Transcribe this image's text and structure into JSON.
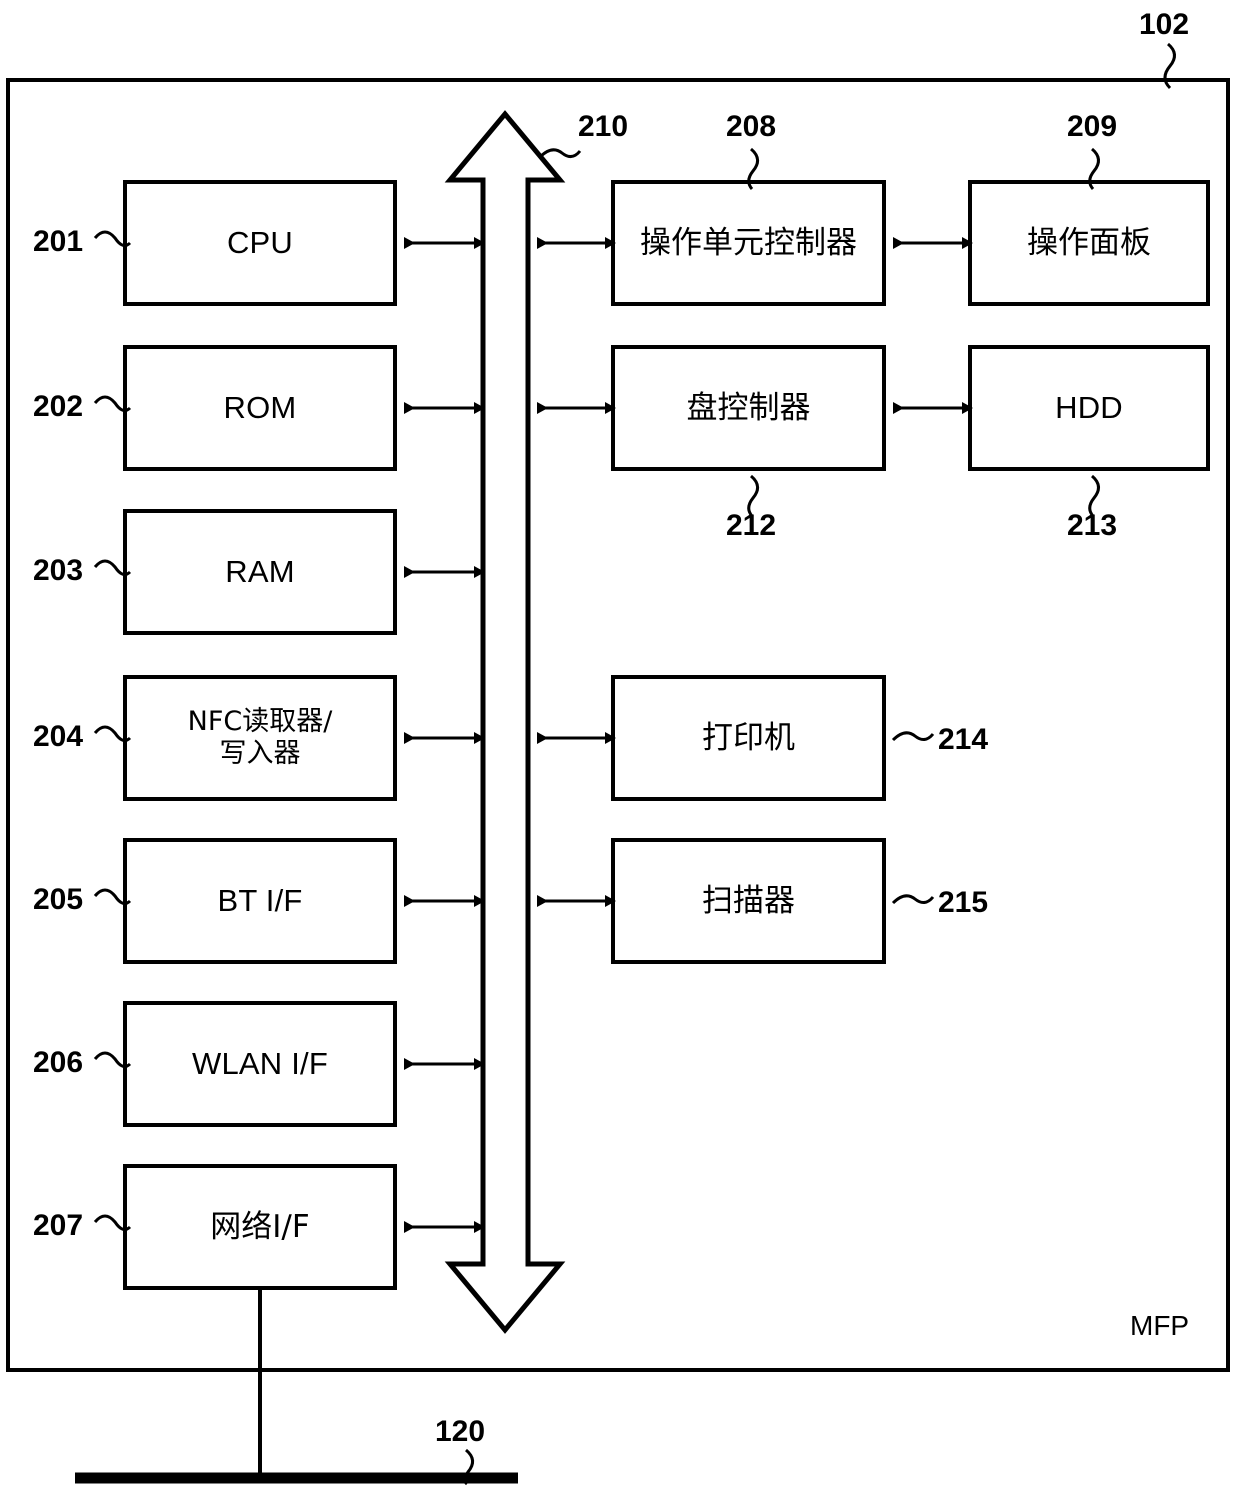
{
  "figure": {
    "outer_label": "102",
    "enclosure_name": "MFP",
    "network_label": "120",
    "bus_label": "210",
    "line_color": "#000000",
    "background_color": "#ffffff"
  },
  "left_column": [
    {
      "ref": "201",
      "label": "CPU",
      "script": "latin"
    },
    {
      "ref": "202",
      "label": "ROM",
      "script": "latin"
    },
    {
      "ref": "203",
      "label": "RAM",
      "script": "latin"
    },
    {
      "ref": "204",
      "label": "NFC读取器/\n写入器",
      "script": "cjk"
    },
    {
      "ref": "205",
      "label": "BT I/F",
      "script": "latin"
    },
    {
      "ref": "206",
      "label": "WLAN I/F",
      "script": "latin"
    },
    {
      "ref": "207",
      "label": "网络I/F",
      "script": "cjk"
    }
  ],
  "right_column": [
    {
      "ref": "208",
      "label": "操作单元控制器",
      "script": "cjk"
    },
    {
      "ref": "212",
      "label": "盘控制器",
      "script": "cjk"
    },
    {
      "ref": "214",
      "label": "打印机",
      "script": "cjk"
    },
    {
      "ref": "215",
      "label": "扫描器",
      "script": "cjk"
    }
  ],
  "far_right_column": [
    {
      "ref": "209",
      "label": "操作面板",
      "script": "cjk"
    },
    {
      "ref": "213",
      "label": "HDD",
      "script": "latin"
    }
  ]
}
